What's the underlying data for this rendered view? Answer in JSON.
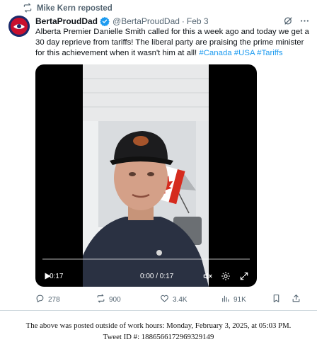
{
  "repost": {
    "label": "Mike Kern reposted",
    "icon": "repost-icon"
  },
  "author": {
    "display_name": "BertaProudDad",
    "handle": "@BertaProudDad",
    "separator": "·",
    "date": "Feb 3",
    "avatar_icon": "avatar-logo",
    "verified_color": "#1d9bf0"
  },
  "tweet": {
    "text": "Alberta Premier Danielle Smith called for this a week ago and today we get a 30 day reprieve from tariffs! The liberal party are praising the prime minister for this achievement when it wasn't him at all!",
    "hashtags": [
      "#Canada",
      "#USA",
      "#Tariffs"
    ]
  },
  "video": {
    "elapsed_label": "0:17",
    "time_display": "0:00 / 0:17",
    "progress": 0
  },
  "actions": {
    "replies": "278",
    "reposts": "900",
    "likes": "3.4K",
    "views": "91K"
  },
  "footer": {
    "line1": "The above was posted outside of work hours: Monday, February 3, 2025, at 05:03 PM.",
    "line2": "Tweet ID #: 1886566172969329149"
  },
  "colors": {
    "accent": "#1d9bf0",
    "secondary_text": "#536471",
    "flag_red": "#d52b1e"
  }
}
